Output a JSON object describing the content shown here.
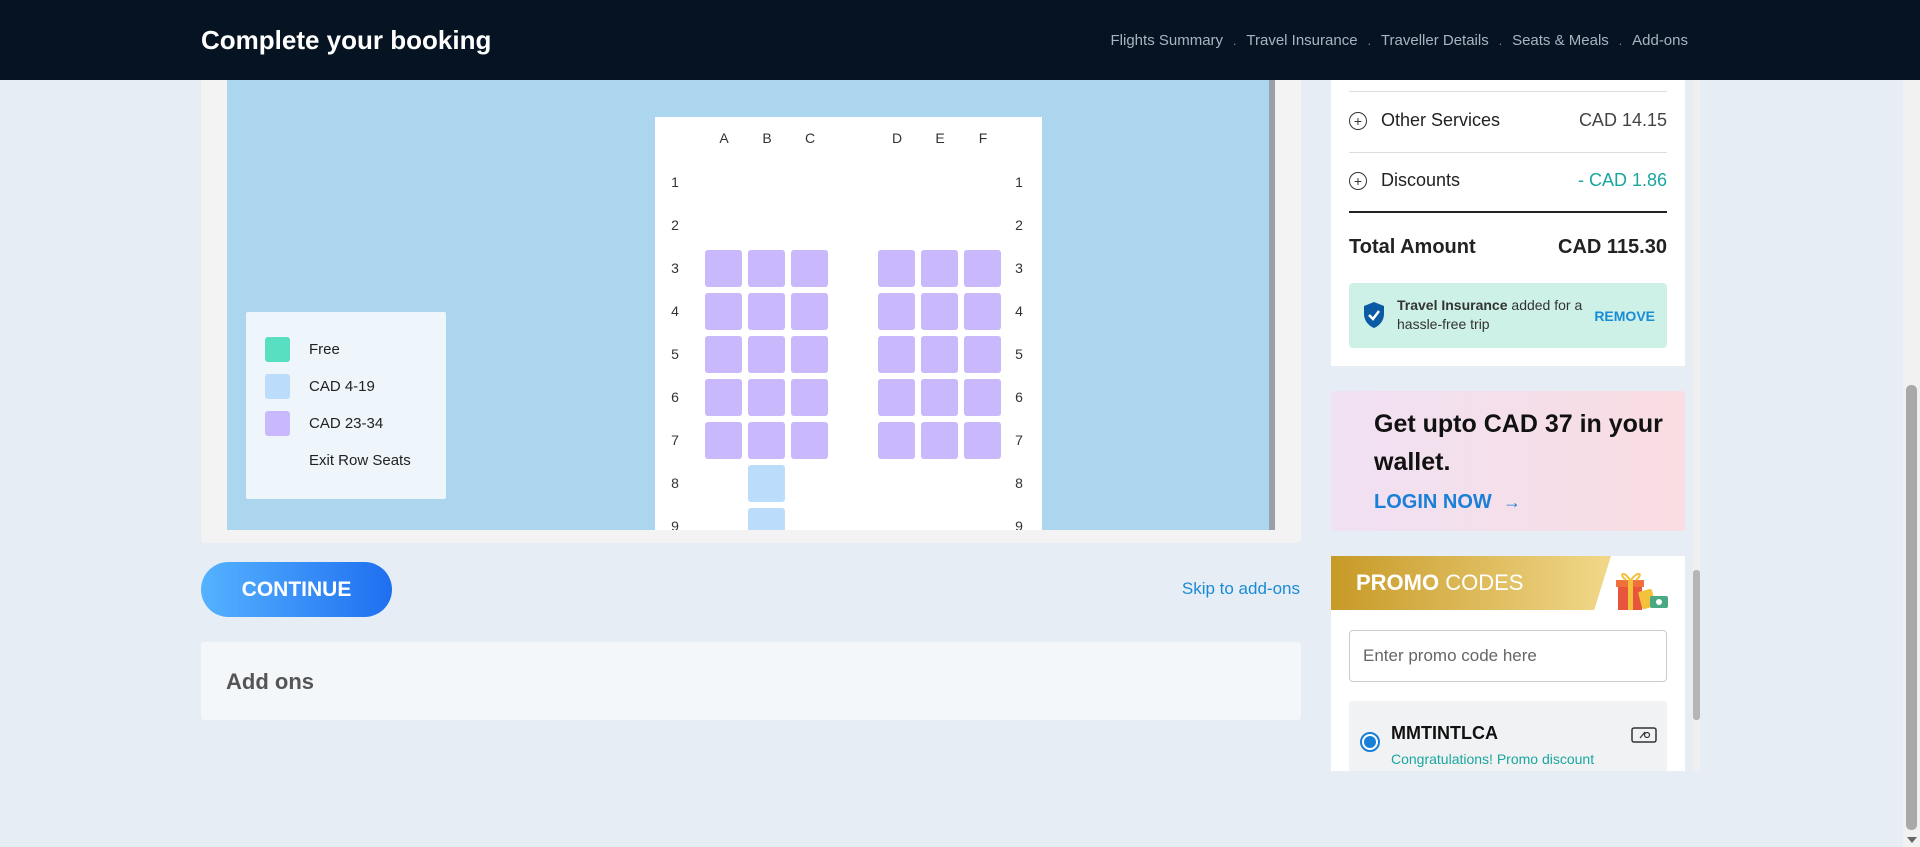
{
  "header": {
    "title": "Complete your booking",
    "steps": [
      "Flights Summary",
      "Travel Insurance",
      "Traveller Details",
      "Seats & Meals",
      "Add-ons"
    ],
    "separator": "."
  },
  "seat_map": {
    "columns_left": [
      "A",
      "B",
      "C"
    ],
    "columns_right": [
      "D",
      "E",
      "F"
    ],
    "rows": [
      "1",
      "2",
      "3",
      "4",
      "5",
      "6",
      "7",
      "8",
      "9"
    ],
    "purple_rows": [
      3,
      4,
      5,
      6,
      7
    ],
    "blue_seats": [
      {
        "row": 8,
        "col": "B"
      },
      {
        "row": 9,
        "col": "B"
      }
    ],
    "legend": [
      {
        "label": "Free",
        "color": "#58dfc1"
      },
      {
        "label": "CAD 4-19",
        "color": "#bcdcfb"
      },
      {
        "label": "CAD 23-34",
        "color": "#c9b8fb"
      },
      {
        "label": "Exit Row Seats",
        "color": ""
      }
    ]
  },
  "actions": {
    "continue_label": "CONTINUE",
    "skip_label": "Skip to add-ons"
  },
  "addons": {
    "title": "Add ons"
  },
  "fare": {
    "other_services": {
      "label": "Other Services",
      "amount": "CAD 14.15"
    },
    "discounts": {
      "label": "Discounts",
      "amount": "- CAD 1.86"
    },
    "total": {
      "label": "Total Amount",
      "amount": "CAD 115.30"
    },
    "insurance": {
      "bold": "Travel Insurance",
      "rest": " added for a hassle-free trip",
      "remove_label": "REMOVE"
    }
  },
  "wallet": {
    "headline": "Get upto CAD 37 in your wallet.",
    "login_label": "LOGIN NOW",
    "arrow": "→"
  },
  "promo": {
    "title_bold": "PROMO",
    "title_rest": " CODES",
    "placeholder": "Enter promo code here",
    "option": {
      "code": "MMTINTLCA",
      "message": "Congratulations! Promo discount"
    }
  }
}
